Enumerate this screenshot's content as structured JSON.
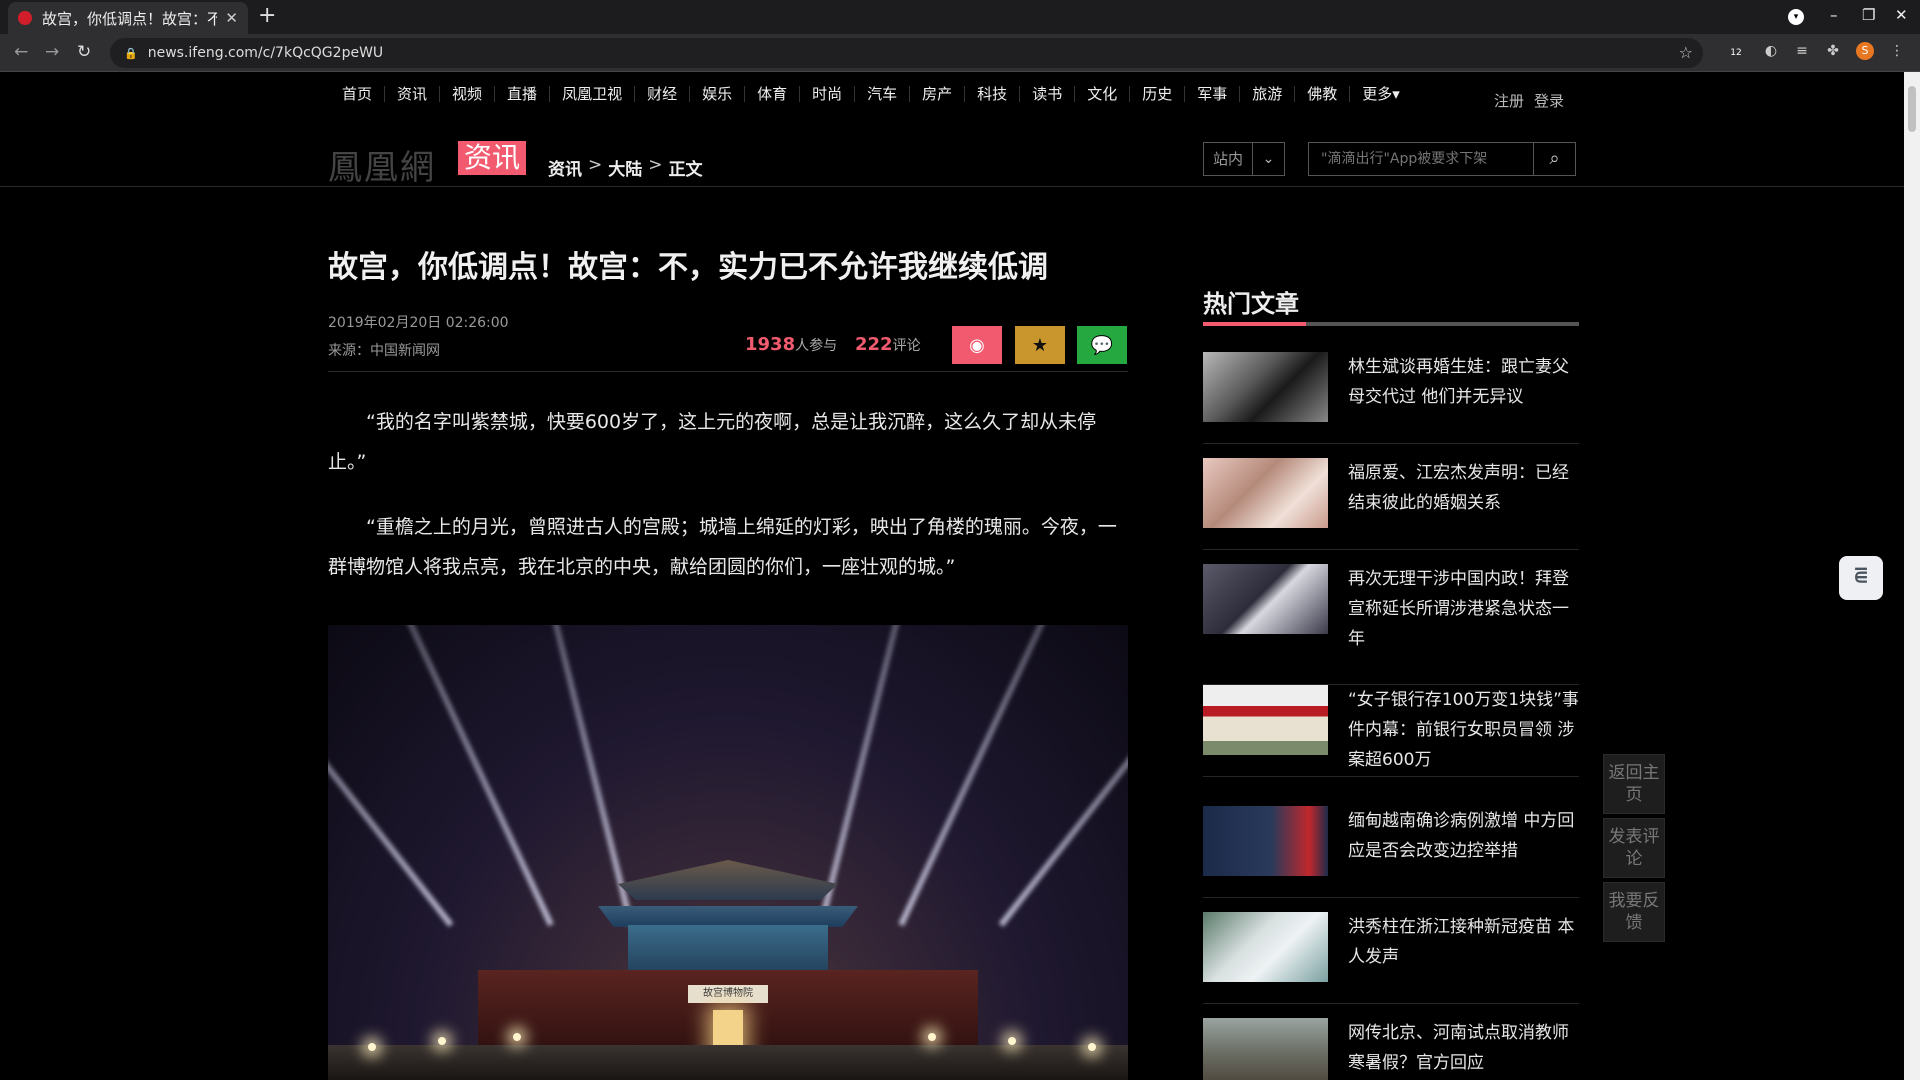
{
  "browser": {
    "tab_title": "故宫，你低调点！故宫：不，实力已不允许我继续低调",
    "url": "news.ifeng.com/c/7kQcQG2peWU",
    "ext_badge": "12",
    "profile_initial": "S"
  },
  "nav": {
    "items": [
      "首页",
      "资讯",
      "视频",
      "直播",
      "凤凰卫视",
      "财经",
      "娱乐",
      "体育",
      "时尚",
      "汽车",
      "房产",
      "科技",
      "读书",
      "文化",
      "历史",
      "军事",
      "旅游",
      "佛教",
      "更多▾"
    ],
    "register": "注册",
    "login": "登录"
  },
  "brand": {
    "logo_text": "鳳凰網",
    "section_badge": "资讯",
    "breadcrumb": [
      "资讯",
      "大陆",
      "正文"
    ],
    "breadcrumb_sep": ">"
  },
  "search": {
    "scope": "站内",
    "placeholder": "\"滴滴出行\"App被要求下架"
  },
  "article": {
    "title": "故宫，你低调点！故宫：不，实力已不允许我继续低调",
    "date": "2019年02月20日 02:26:00",
    "source": "来源：中国新闻网",
    "participants": "1938",
    "participants_label": "人参与",
    "comments": "222",
    "comments_label": "评论",
    "paragraphs": [
      "“我的名字叫紫禁城，快要600岁了，这上元的夜啊，总是让我沉醉，这么久了却从未停止。”",
      "“重檐之上的月光，曾照进古人的宫殿；城墙上绵延的灯彩，映出了角楼的瑰丽。今夜，一群博物馆人将我点亮，我在北京的中央，献给团圆的你们，一座壮观的城。”"
    ],
    "photo_plaque": "故宫博物院"
  },
  "hot": {
    "title": "热门文章",
    "items": [
      {
        "text": "林生斌谈再婚生娃：跟亡妻父母交代过 他们并无异议"
      },
      {
        "text": "福原爱、江宏杰发声明：已经结束彼此的婚姻关系"
      },
      {
        "text": "再次无理干涉中国内政！拜登宣称延长所谓涉港紧急状态一年"
      },
      {
        "text": "“女子银行存100万变1块钱”事件内幕：前银行女职员冒领 涉案超600万"
      },
      {
        "text": "缅甸越南确诊病例激增 中方回应是否会改变边控举措"
      },
      {
        "text": "洪秀柱在浙江接种新冠疫苗 本人发声"
      },
      {
        "text": "网传北京、河南试点取消教师寒暑假？官方回应"
      }
    ]
  },
  "side_buttons": {
    "home": "返回主页",
    "comment": "发表评论",
    "feedback": "我要反馈"
  },
  "colors": {
    "accent": "#f25a6f",
    "favorite": "#c9962e",
    "wechat": "#24a83f"
  }
}
